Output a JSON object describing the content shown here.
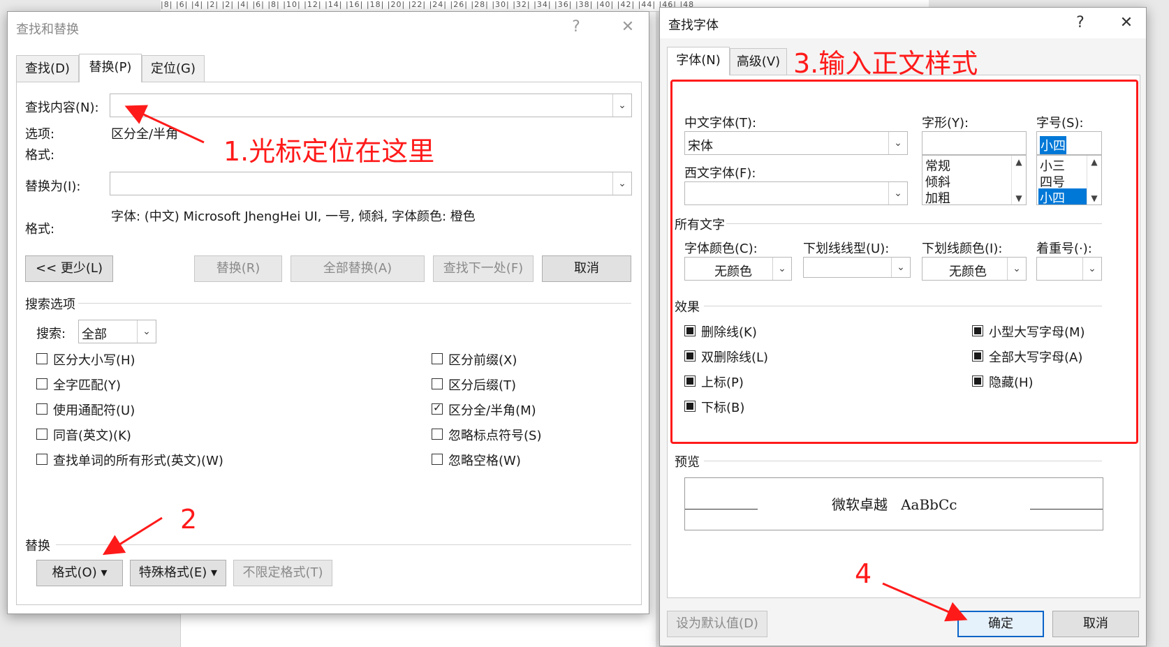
{
  "ruler": {
    "text": "|8| |6| |4| |2| |2| |4| |6| |8| |10| |12| |14| |16| |18| |20| |22| |24| |26| |28| |30| |32| |34| |36| |38| |40| |42| |44| |46| |48"
  },
  "find_replace": {
    "title": "查找和替换",
    "help": "?",
    "close": "✕",
    "tabs": [
      {
        "label": "查找(D)"
      },
      {
        "label": "替换(P)"
      },
      {
        "label": "定位(G)"
      }
    ],
    "find_label": "查找内容(N):",
    "find_value": "",
    "options_label": "选项:",
    "options_value": "区分全/半角",
    "format_label": "格式:",
    "replace_label": "替换为(I):",
    "replace_value": "",
    "format_label2": "格式:",
    "format_value": "字体: (中文) Microsoft JhengHei UI, 一号, 倾斜, 字体颜色: 橙色",
    "less_button": "<< 更少(L)",
    "replace_button": "替换(R)",
    "replace_all_button": "全部替换(A)",
    "find_next_button": "查找下一处(F)",
    "cancel_button": "取消",
    "search_options_heading": "搜索选项",
    "search_label": "搜索:",
    "search_value": "全部",
    "left_options": [
      {
        "label": "区分大小写(H)",
        "checked": false
      },
      {
        "label": "全字匹配(Y)",
        "checked": false
      },
      {
        "label": "使用通配符(U)",
        "checked": false
      },
      {
        "label": "同音(英文)(K)",
        "checked": false
      },
      {
        "label": "查找单词的所有形式(英文)(W)",
        "checked": false
      }
    ],
    "right_options": [
      {
        "label": "区分前缀(X)",
        "checked": false
      },
      {
        "label": "区分后缀(T)",
        "checked": false
      },
      {
        "label": "区分全/半角(M)",
        "checked": true
      },
      {
        "label": "忽略标点符号(S)",
        "checked": false
      },
      {
        "label": "忽略空格(W)",
        "checked": false
      }
    ],
    "replace_heading": "替换",
    "format_button": "格式(O)",
    "special_button": "特殊格式(E)",
    "no_format_button": "不限定格式(T)"
  },
  "find_font": {
    "title": "查找字体",
    "help": "?",
    "close": "✕",
    "tabs": [
      {
        "label": "字体(N)"
      },
      {
        "label": "高级(V)"
      }
    ],
    "cn_font_label": "中文字体(T):",
    "cn_font_value": "宋体",
    "west_font_label": "西文字体(F):",
    "west_font_value": "",
    "style_label": "字形(Y):",
    "style_value": "",
    "style_items": [
      "常规",
      "倾斜",
      "加粗"
    ],
    "size_label": "字号(S):",
    "size_value": "小四",
    "size_items": [
      "小三",
      "四号",
      "小四"
    ],
    "size_selected": "小四",
    "all_text_heading": "所有文字",
    "font_color_label": "字体颜色(C):",
    "font_color_value": "无颜色",
    "underline_style_label": "下划线线型(U):",
    "underline_style_value": "",
    "underline_color_label": "下划线颜色(I):",
    "underline_color_value": "无颜色",
    "emphasis_label": "着重号(·):",
    "emphasis_value": "",
    "effects_heading": "效果",
    "effects_left": [
      "删除线(K)",
      "双删除线(L)",
      "上标(P)",
      "下标(B)"
    ],
    "effects_right": [
      "小型大写字母(M)",
      "全部大写字母(A)",
      "隐藏(H)"
    ],
    "preview_heading": "预览",
    "preview_text": "微软卓越   AaBbCc",
    "set_default_button": "设为默认值(D)",
    "ok_button": "确定",
    "cancel_button": "取消"
  },
  "annotations": {
    "step1": "1.光标定位在这里",
    "step2": "2",
    "step3": "3.输入正文样式",
    "step4": "4",
    "color": "#ff1a1a"
  }
}
